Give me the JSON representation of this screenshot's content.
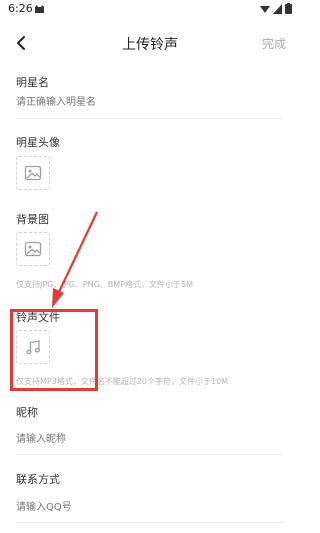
{
  "status": {
    "time": "6:26"
  },
  "header": {
    "title": "上传铃声",
    "done_label": "完成"
  },
  "fields": {
    "star_name": {
      "label": "明星名",
      "placeholder": "请正确输入明星名"
    },
    "star_avatar": {
      "label": "明星头像"
    },
    "background": {
      "label": "背景图",
      "hint": "仅支持JPG、JPG、PNG、BMP格式，文件小于5M"
    },
    "ringtone_file": {
      "label": "铃声文件",
      "hint": "仅支持MP3格式，文件名不能超过20个字符，文件小于10M"
    },
    "nickname": {
      "label": "昵称",
      "placeholder": "请输入昵称"
    },
    "contact": {
      "label": "联系方式",
      "placeholder": "请输入QQ号"
    }
  },
  "icons": {
    "back": "chevron-left-icon",
    "image_upload": "image-icon",
    "music_upload": "music-note-icon"
  },
  "colors": {
    "annotation": "#e53935",
    "hint": "#b3b3b3",
    "done": "#aaaaaa"
  }
}
